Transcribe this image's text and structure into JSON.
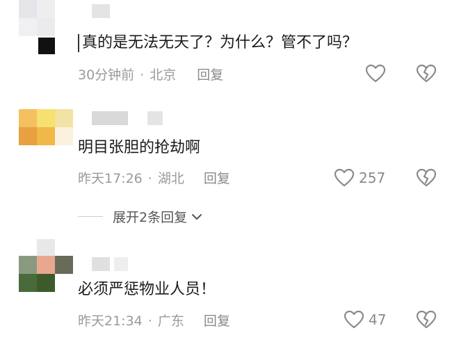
{
  "comments": [
    {
      "text": "真的是无法无天了？为什么？管不了吗？",
      "time": "30分钟前",
      "location": "北京",
      "reply_label": "回复",
      "likes": ""
    },
    {
      "text": "明目张胆的抢劫啊",
      "time": "昨天17:26",
      "location": "湖北",
      "reply_label": "回复",
      "likes": "257",
      "expand_label": "展开2条回复"
    },
    {
      "text": "必须严惩物业人员！",
      "time": "昨天21:34",
      "location": "广东",
      "reply_label": "回复",
      "likes": "47"
    }
  ],
  "separator": "·",
  "colors": {
    "text": "#1a1a1a",
    "meta": "#9a9a9a",
    "icon": "#8a8a8a"
  }
}
